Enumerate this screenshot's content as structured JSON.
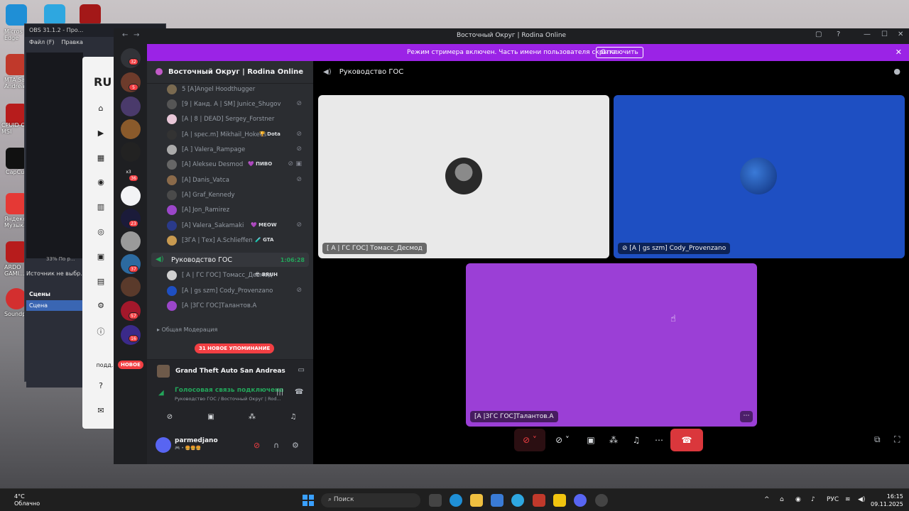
{
  "window": {
    "title": "Восточный Округ | Rodina Online"
  },
  "banner": {
    "text": "Режим стримера включен. Часть имени пользователя скрыта.",
    "button": "Отключить"
  },
  "server": {
    "name": "Восточный Округ | Rodina Online"
  },
  "rail": {
    "badges": [
      "32",
      "5",
      "36",
      "23",
      "37",
      "57",
      "16"
    ],
    "new_label": "НОВОЕ",
    "x3": "x3"
  },
  "members_top": [
    {
      "name": "5 [A]Angel Hoodthugger",
      "tag": ""
    },
    {
      "name": "[9 | Канд. A | SM] Junice_Shugov",
      "tag": ""
    },
    {
      "name": "[A | 8 | DEAD] Sergey_Forstner",
      "tag": ""
    },
    {
      "name": "[A | spec.m] Mikhail_Hokees",
      "tag": "🏆 Dota"
    },
    {
      "name": "[A ] Valera_Rampage",
      "tag": ""
    },
    {
      "name": "[A] Alekseu Desmod",
      "tag": "💜 ПИВО"
    },
    {
      "name": "[A] Danis_Vatca",
      "tag": ""
    },
    {
      "name": "[A] Graf_Kennedy",
      "tag": ""
    },
    {
      "name": "[A] Jon_Ramirez",
      "tag": ""
    },
    {
      "name": "[A] Valera_Sakamaki",
      "tag": "💜 MEOW"
    },
    {
      "name": "[ЗГА | Тех] A.Schlieffen",
      "tag": "🧪 GTA"
    }
  ],
  "voice_channel": {
    "name": "Руководство ГОС",
    "time": "1:06:28"
  },
  "voice_members": [
    {
      "name": "[ A | ГС ГОС] Томасс_Десмод",
      "tag": "😎 BRUH"
    },
    {
      "name": "[A | gs szm] Cody_Provenzano",
      "tag": ""
    },
    {
      "name": "[A |ЗГС ГОС]Талантов.А",
      "tag": ""
    }
  ],
  "category": {
    "name": "Общая Модерация"
  },
  "mentions": "31 НОВОЕ УПОМИНАНИЕ",
  "activity": {
    "name": "Grand Theft Auto San Andreas"
  },
  "voice_panel": {
    "status": "Голосовая связь подключена",
    "sub": "Руководство ГОС / Восточный Округ | Rod..."
  },
  "user": {
    "name": "parmedjano",
    "status": "🎮 • 🍔🍔🍔"
  },
  "call": {
    "header": "Руководство ГОС",
    "tiles": [
      {
        "label": "[ A | ГС ГОС] Томасс_Десмод"
      },
      {
        "label": "[A | gs szm] Cody_Provenzano"
      },
      {
        "label": "[A |ЗГС ГОС]Талантов.А"
      }
    ]
  },
  "obs": {
    "title": "OBS 31.1.2 - Про...",
    "menu": [
      "Файл (F)",
      "Правка"
    ],
    "zoom": "33%  По р...",
    "source_hint": "Источник не выбр...",
    "scenes_header": "Сцены",
    "scene": "Сцена"
  },
  "behind_app": {
    "logo": "RU",
    "footer": "подд..."
  },
  "desktop_labels": [
    "Micros Edge",
    "MTA Sa Andreas",
    "CPUID Cl MSI",
    "CapCut",
    "Яндекс Музыка",
    "ARDO GAMI...",
    "Soundp..."
  ],
  "taskbar": {
    "weather_temp": "4°C",
    "weather_desc": "Облачно",
    "search": "Поиск",
    "lang": "РУС",
    "time": "16:15",
    "date": "09.11.2025"
  }
}
